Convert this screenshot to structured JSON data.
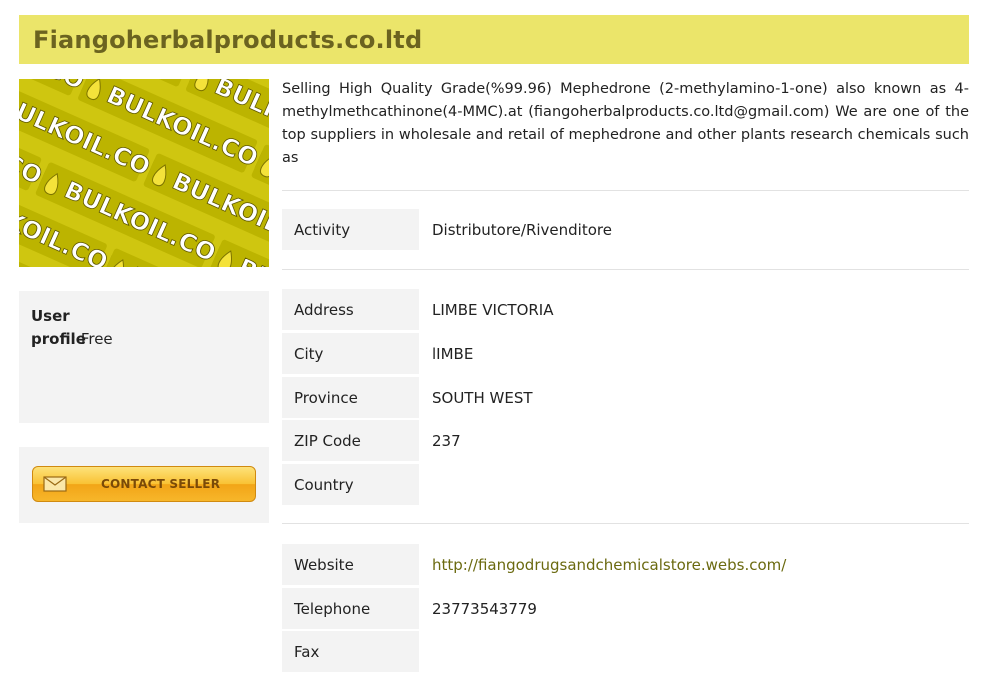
{
  "seller": {
    "name": "Fiangoherbalproducts.co.ltd",
    "logo_text": "BULKOIL.COM",
    "description": "Selling High Quality Grade(%99.96) Mephedrone (2-methylamino-1-one) also known as 4-methylmethcathinone(4-MMC).at (fiangoherbalproducts.co.ltd@gmail.com) We are one of the top suppliers in wholesale and retail of mephedrone and other plants research chemicals such as"
  },
  "sidebar": {
    "profile_label": "User profile",
    "profile_value": ": Free",
    "contact_button": "CONTACT SELLER"
  },
  "details": {
    "activity": {
      "label": "Activity",
      "value": "Distributore/Rivenditore"
    },
    "address": {
      "label": "Address",
      "value": "LIMBE VICTORIA"
    },
    "city": {
      "label": "City",
      "value": "lIMBE"
    },
    "province": {
      "label": "Province",
      "value": "SOUTH WEST"
    },
    "zip": {
      "label": "ZIP Code",
      "value": "237"
    },
    "country": {
      "label": "Country",
      "value": ""
    },
    "website": {
      "label": "Website",
      "value": "http://fiangodrugsandchemicalstore.webs.com/"
    },
    "telephone": {
      "label": "Telephone",
      "value": "23773543779"
    },
    "fax": {
      "label": "Fax",
      "value": ""
    }
  },
  "colors": {
    "header_bg": "#ebe56a",
    "header_text": "#6b6320",
    "label_bg": "#f3f3f3",
    "link": "#6b6a10",
    "button": "#f9c234"
  },
  "icons": {
    "contact_button_icon": "envelope-icon"
  }
}
